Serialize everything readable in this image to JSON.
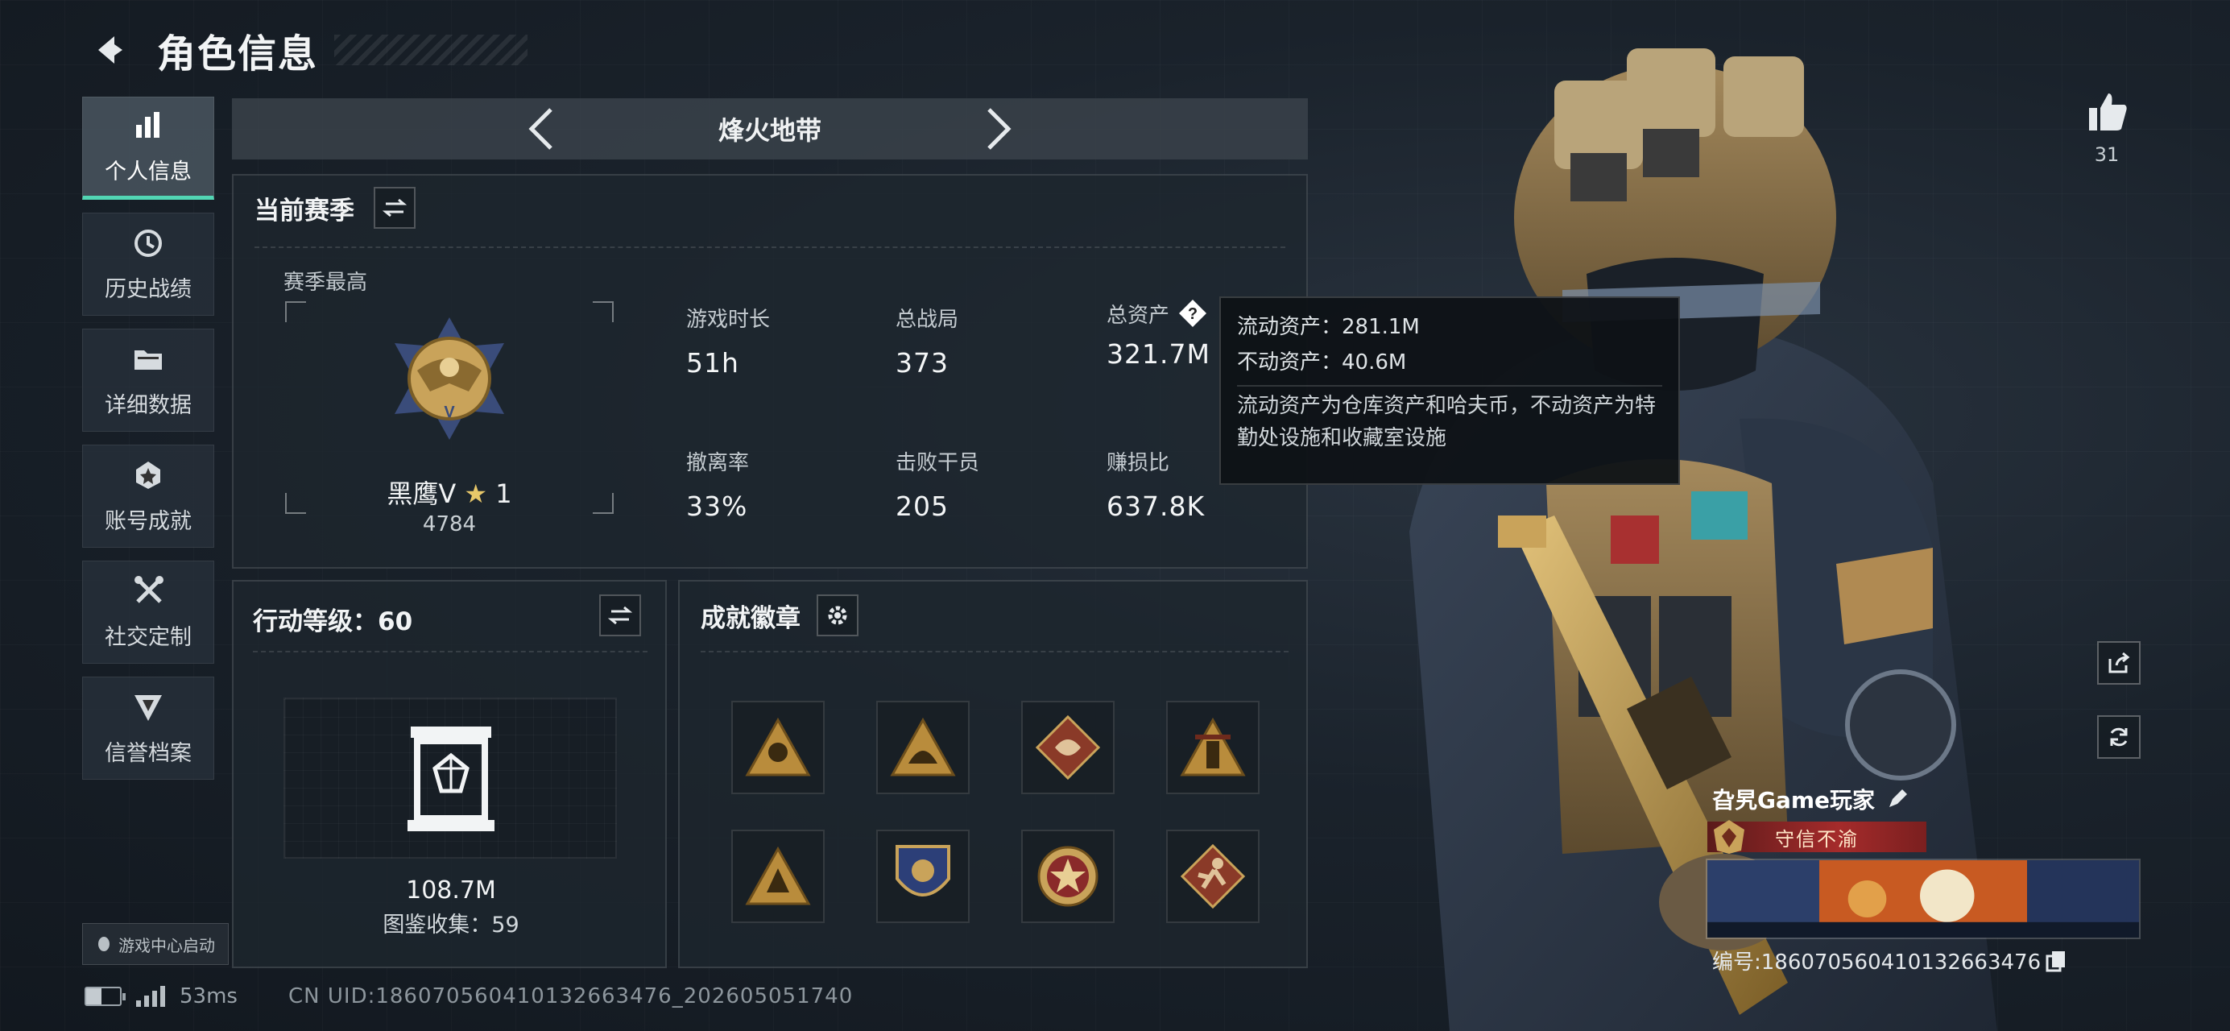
{
  "header": {
    "title": "角色信息"
  },
  "sidebar": {
    "items": [
      {
        "label": "个人信息",
        "icon": "bar-chart-icon",
        "active": true
      },
      {
        "label": "历史战绩",
        "icon": "history-icon",
        "active": false
      },
      {
        "label": "详细数据",
        "icon": "folder-icon",
        "active": false
      },
      {
        "label": "账号成就",
        "icon": "achievement-icon",
        "active": false
      },
      {
        "label": "社交定制",
        "icon": "tools-icon",
        "active": false
      },
      {
        "label": "信誉档案",
        "icon": "credit-icon",
        "active": false
      }
    ],
    "game_center_launch": "游戏中心启动"
  },
  "status": {
    "ping": "53ms",
    "uid": "CN UID:18607056041013266347​6_202605051740",
    "battery_level": 0.45
  },
  "mode": {
    "name": "烽火地带"
  },
  "season": {
    "title": "当前赛季",
    "highest_label": "赛季最高",
    "rank_name": "黑鹰V",
    "rank_stars": "1",
    "rank_score": "4784",
    "stats": [
      {
        "key": "游戏时长",
        "value": "51h"
      },
      {
        "key": "总战局",
        "value": "373"
      },
      {
        "key": "总资产",
        "value": "321.7M"
      },
      {
        "key": "撤离率",
        "value": "33%"
      },
      {
        "key": "击败干员",
        "value": "205"
      },
      {
        "key": "赚损比",
        "value": "637.8K"
      }
    ]
  },
  "tooltip": {
    "liquid": "流动资产：281.1M",
    "fixed": "不动资产：40.6M",
    "desc": "流动资产为仓库资产和哈夫币，不动资产为特勤处设施和收藏室设施"
  },
  "level": {
    "title": "行动等级：60",
    "value": "108.7M",
    "collection": "图鉴收集：59"
  },
  "badges": {
    "title": "成就徽章",
    "items": [
      "badge-soldier",
      "badge-helmet",
      "badge-dragon",
      "badge-tower",
      "badge-triangle",
      "badge-shield",
      "badge-star",
      "badge-runner"
    ]
  },
  "profile": {
    "likes": "31",
    "player_name": "旮旯Game玩家",
    "honor": "守信不渝",
    "id": "编号:18607056041013266347​6"
  },
  "colors": {
    "accent": "#52d6b4",
    "honor": "#a52b2b",
    "gold": "#c9a35a"
  }
}
